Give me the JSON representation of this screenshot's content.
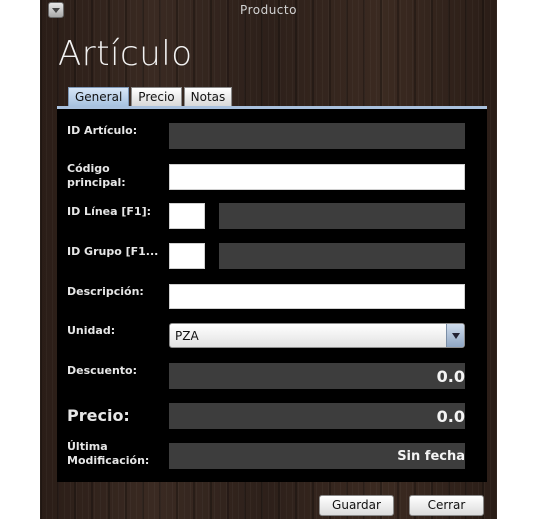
{
  "window": {
    "title": "Producto"
  },
  "heading": "Artículo",
  "tabs": [
    {
      "label": "General",
      "active": true
    },
    {
      "label": "Precio",
      "active": false
    },
    {
      "label": "Notas",
      "active": false
    }
  ],
  "form": {
    "id_articulo": {
      "label": "ID Artículo:",
      "value": ""
    },
    "codigo_principal": {
      "label_line1": "Código",
      "label_line2": "principal:",
      "value": ""
    },
    "id_linea": {
      "label": "ID Línea [F1]:",
      "value": "",
      "name": ""
    },
    "id_grupo": {
      "label": "ID Grupo [F1...",
      "value": "",
      "name": ""
    },
    "descripcion": {
      "label": "Descripción:",
      "value": ""
    },
    "unidad": {
      "label": "Unidad:",
      "value": "PZA"
    },
    "descuento": {
      "label": "Descuento:",
      "value": "0.0"
    },
    "precio": {
      "label": "Precio:",
      "value": "0.0"
    },
    "ultima_modificacion": {
      "label_line1": "Última",
      "label_line2": "Modificación:",
      "value": "Sin fecha"
    }
  },
  "buttons": {
    "guardar": "Guardar",
    "cerrar": "Cerrar"
  },
  "colors": {
    "panel": "#000000",
    "field_dark": "#3d3d3d",
    "tab_active": "#a7c2e0"
  },
  "icons": {
    "window_menu": "triangle-down-icon",
    "select_arrow": "chevron-down-icon"
  }
}
